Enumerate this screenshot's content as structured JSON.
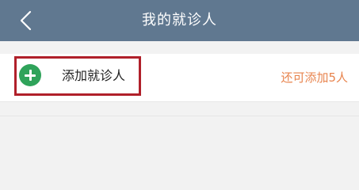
{
  "header": {
    "title": "我的就诊人",
    "back_icon": "back-chevron-icon",
    "background_color": "#607890"
  },
  "patients": {
    "add_label": "添加就诊人",
    "add_icon": "plus-circle-icon",
    "add_icon_color": "#2fa35a",
    "remaining_text": "还可添加5人",
    "remaining_color": "#e8844e",
    "highlight_color": "#b0202a"
  }
}
